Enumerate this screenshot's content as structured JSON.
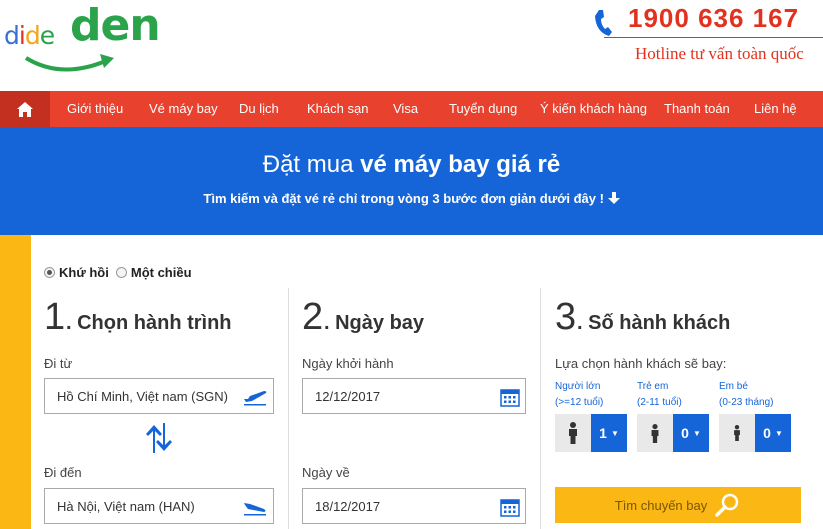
{
  "logo": {
    "small": [
      "d",
      "i",
      "d",
      "e"
    ],
    "big": "den"
  },
  "hotline": {
    "number": "1900 636 167",
    "text": "Hotline tư vấn toàn quốc"
  },
  "nav": {
    "items": [
      "Giới thiệu",
      "Vé máy bay",
      "Du lịch",
      "Khách sạn",
      "Visa",
      "Tuyển dụng",
      "Ý kiến khách hàng",
      "Thanh toán",
      "Liên hệ"
    ]
  },
  "banner": {
    "title_plain": "Đặt mua ",
    "title_bold": "vé máy bay giá rẻ",
    "subtitle": "Tìm kiếm và đặt vé rẻ chỉ trong vòng 3 bước đơn giản dưới đây !"
  },
  "trip_type": {
    "round_trip": "Khứ hồi",
    "one_way": "Một chiều",
    "selected": "round_trip"
  },
  "step1": {
    "num": "1",
    "title": ". Chọn hành trình",
    "from_label": "Đi từ",
    "from_value": "Hồ Chí Minh, Việt nam (SGN)",
    "to_label": "Đi đến",
    "to_value": "Hà Nội, Việt nam (HAN)"
  },
  "step2": {
    "num": "2",
    "title": ". Ngày bay",
    "depart_label": "Ngày khởi hành",
    "depart_value": "12/12/2017",
    "return_label": "Ngày về",
    "return_value": "18/12/2017"
  },
  "step3": {
    "num": "3",
    "title": ". Số hành khách",
    "hint": "Lựa chọn hành khách sẽ bay:",
    "adult": {
      "label": "Người lớn",
      "sub": "(>=12 tuổi)",
      "value": "1"
    },
    "child": {
      "label": "Trẻ em",
      "sub": "(2-11 tuổi)",
      "value": "0"
    },
    "infant": {
      "label": "Em bé",
      "sub": "(0-23 tháng)",
      "value": "0"
    }
  },
  "search_button": "Tìm chuyến bay",
  "colors": {
    "brand_red": "#e8412e",
    "brand_blue": "#1565d8",
    "accent_yellow": "#fbb714",
    "logo_green": "#2aa34a"
  }
}
